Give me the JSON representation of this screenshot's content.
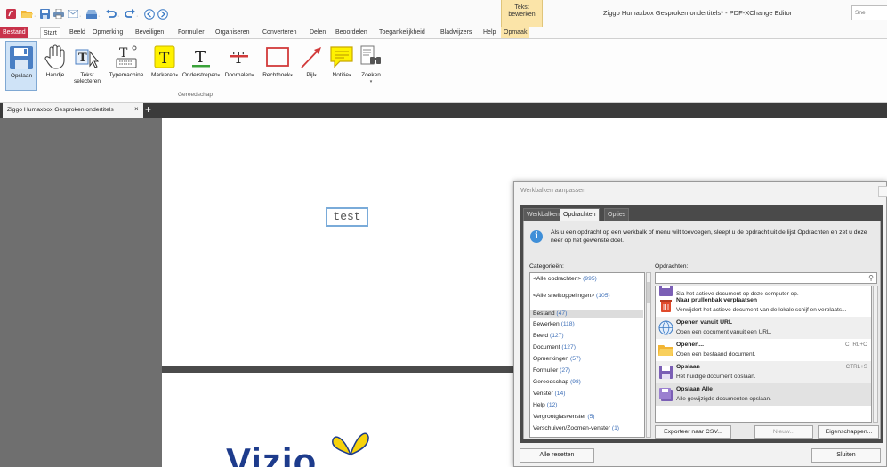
{
  "app": {
    "window_title": "Ziggo Humaxbox Gesproken ondertitels* - PDF-XChange Editor",
    "search_placeholder": "Sne",
    "context_tab": {
      "line1": "Tekst",
      "line2": "bewerken"
    }
  },
  "menu": {
    "tabs": [
      "Bestand",
      "Start",
      "Beeld",
      "Opmerking",
      "Beveiligen",
      "Formulier",
      "Organiseren",
      "Converteren",
      "Delen",
      "Beoordelen",
      "Toegankelijkheid",
      "Bladwijzers",
      "Help",
      "Opmaak"
    ],
    "active": "Start"
  },
  "ribbon": {
    "group_label": "Gereedschap",
    "buttons": [
      {
        "label": "Opslaan",
        "icon": "save-icon",
        "active": true
      },
      {
        "label": "Handje",
        "icon": "hand-icon"
      },
      {
        "label1": "Tekst",
        "label2": "selecteren",
        "icon": "text-select-icon"
      },
      {
        "label": "Typemachine",
        "icon": "typewriter-icon"
      },
      {
        "label": "Markeren",
        "icon": "highlight-icon"
      },
      {
        "label": "Onderstrepen",
        "icon": "underline-icon"
      },
      {
        "label": "Doorhalen",
        "icon": "strikeout-icon"
      },
      {
        "label": "Rechthoek",
        "icon": "rectangle-icon"
      },
      {
        "label": "Pijl",
        "icon": "arrow-icon"
      },
      {
        "label": "Notitie",
        "icon": "note-icon"
      },
      {
        "label": "Zoeken",
        "icon": "binoculars-icon"
      }
    ]
  },
  "document": {
    "tab_title": "Ziggo Humaxbox Gesproken ondertitels",
    "typed_text": "test",
    "logo_text": "Vizio"
  },
  "dialog": {
    "title": "Werkbalken aanpassen",
    "tabs": [
      "Werkbalken",
      "Opdrachten",
      "Opties"
    ],
    "active_tab": "Opdrachten",
    "info": "Als u een opdracht op een werkbalk of menu wilt toevoegen, sleept u de opdracht uit de lijst Opdrachten en zet u deze neer op het gewenste doel.",
    "categories_label": "Categorieën:",
    "commands_label": "Opdrachten:",
    "categories": [
      {
        "name": "<Alle opdrachten>",
        "count": "(995)"
      },
      {
        "name": "<Alle snelkoppelingen>",
        "count": "(105)"
      },
      {
        "name": "Bestand",
        "count": "(47)",
        "selected": true
      },
      {
        "name": "Bewerken",
        "count": "(118)"
      },
      {
        "name": "Beeld",
        "count": "(127)"
      },
      {
        "name": "Document",
        "count": "(127)"
      },
      {
        "name": "Opmerkingen",
        "count": "(57)"
      },
      {
        "name": "Formulier",
        "count": "(27)"
      },
      {
        "name": "Gereedschap",
        "count": "(98)"
      },
      {
        "name": "Venster",
        "count": "(14)"
      },
      {
        "name": "Help",
        "count": "(12)"
      },
      {
        "name": "Vergrootglasvenster",
        "count": "(5)"
      },
      {
        "name": "Verschuiven/Zoomen-venster",
        "count": "(1)"
      }
    ],
    "commands": [
      {
        "name": "",
        "desc": "Sla het actieve document op deze computer op.",
        "shortcut": "",
        "icon": "save-as-icon"
      },
      {
        "name": "Naar prullenbak verplaatsen",
        "desc": "Verwijdert het actieve document van de lokale schijf en verplaats...",
        "shortcut": "",
        "icon": "recycle-bin-icon"
      },
      {
        "name": "Openen vanuit URL",
        "desc": "Open een document vanuit een URL.",
        "shortcut": "",
        "icon": "globe-icon"
      },
      {
        "name": "Openen...",
        "desc": "Open een bestaand document.",
        "shortcut": "CTRL+O",
        "icon": "folder-open-icon"
      },
      {
        "name": "Opslaan",
        "desc": "Het huidige document opslaan.",
        "shortcut": "CTRL+S",
        "icon": "save-icon"
      },
      {
        "name": "Opslaan Alle",
        "desc": "Alle gewijzigde documenten opslaan.",
        "shortcut": "",
        "icon": "save-all-icon"
      }
    ],
    "buttons": {
      "export": "Exporteer naar CSV...",
      "new": "Nieuw...",
      "properties": "Eigenschappen...",
      "reset": "Alle resetten",
      "close": "Sluiten"
    }
  },
  "colors": {
    "file_tab": "#c8324a",
    "context_tab": "#fbe4a8",
    "accent": "#3f8fd8",
    "link_count": "#3d6fb8"
  }
}
